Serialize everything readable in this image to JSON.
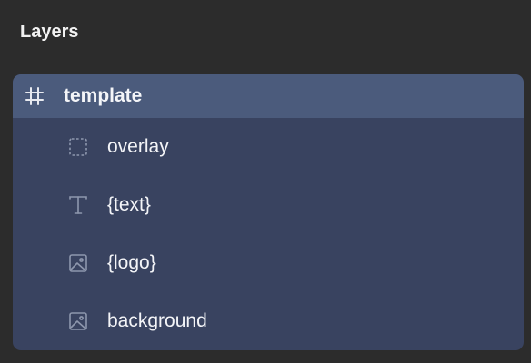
{
  "panel": {
    "title": "Layers"
  },
  "layers": {
    "root": {
      "label": "template",
      "icon": "frame-icon"
    },
    "children": [
      {
        "label": "overlay",
        "icon": "rectangle-icon"
      },
      {
        "label": "{text}",
        "icon": "text-icon"
      },
      {
        "label": "{logo}",
        "icon": "image-icon"
      },
      {
        "label": "background",
        "icon": "image-icon"
      }
    ]
  },
  "colors": {
    "panel_bg": "#2c2c2c",
    "tree_bg": "#394360",
    "selected_row_bg": "#4b5b7c",
    "icon_muted": "#8e97ad",
    "text": "#f4f5f8"
  }
}
